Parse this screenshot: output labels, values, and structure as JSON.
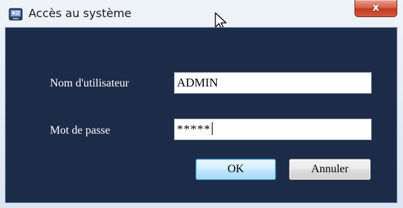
{
  "window": {
    "title": "Accès au système",
    "close_glyph": "x",
    "app_icon": "system-login-icon"
  },
  "form": {
    "username_label": "Nom d'utilisateur",
    "username_value": "ADMIN",
    "password_label": "Mot de passe",
    "password_value": "*****"
  },
  "buttons": {
    "ok_label": "OK",
    "cancel_label": "Annuler"
  },
  "colors": {
    "client_background": "#1c2b47",
    "ok_button_border": "#3c7fb1",
    "close_button": "#c23b22"
  }
}
